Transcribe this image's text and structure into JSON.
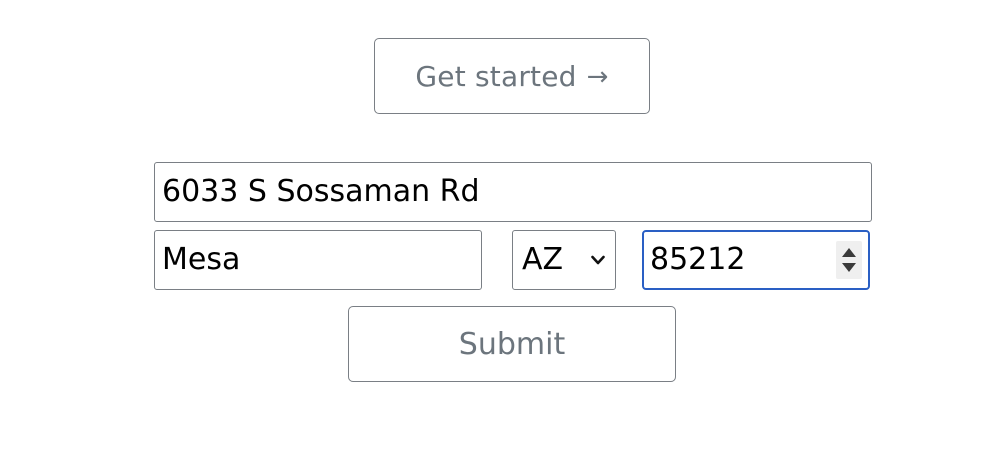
{
  "hero": {
    "get_started_label": "Get started",
    "get_started_arrow": "→"
  },
  "form": {
    "street_value": "6033 S Sossaman Rd",
    "city_value": "Mesa",
    "state_selected": "AZ",
    "zip_value": "85212",
    "submit_label": "Submit"
  },
  "colors": {
    "border": "#7a7f85",
    "button_text": "#6c757d",
    "focus_border": "#2a5fc4"
  },
  "icons": {
    "arrow": "arrow-right-icon",
    "select_chevron": "chevron-down-icon",
    "spinner": "number-spinner-icon"
  }
}
